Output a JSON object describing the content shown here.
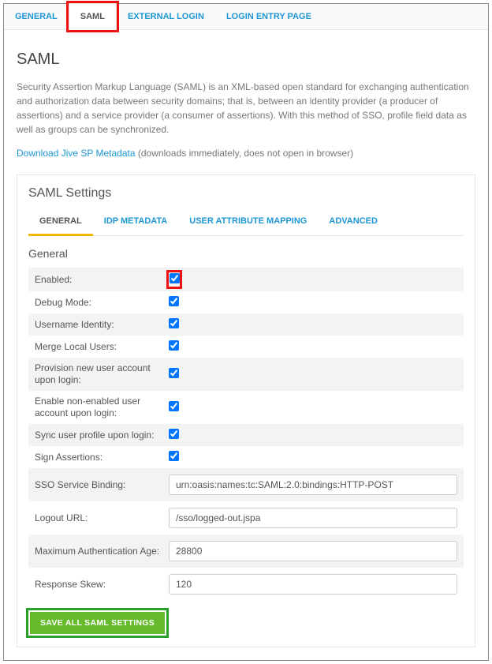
{
  "topnav": {
    "items": [
      {
        "label": "GENERAL"
      },
      {
        "label": "SAML"
      },
      {
        "label": "EXTERNAL LOGIN"
      },
      {
        "label": "LOGIN ENTRY PAGE"
      }
    ]
  },
  "page": {
    "title": "SAML",
    "description": "Security Assertion Markup Language (SAML) is an XML-based open standard for exchanging authentication and authorization data between security domains; that is, between an identity provider (a producer of assertions) and a service provider (a consumer of assertions). With this method of SSO, profile field data as well as groups can be synchronized.",
    "download_link": "Download Jive SP Metadata",
    "download_suffix": " (downloads immediately, does not open in browser)"
  },
  "settings": {
    "panel_title": "SAML Settings",
    "tabs": [
      {
        "label": "GENERAL"
      },
      {
        "label": "IDP METADATA"
      },
      {
        "label": "USER ATTRIBUTE MAPPING"
      },
      {
        "label": "ADVANCED"
      }
    ],
    "section_title": "General",
    "rows": {
      "enabled": {
        "label": "Enabled:"
      },
      "debug": {
        "label": "Debug Mode:"
      },
      "userid": {
        "label": "Username Identity:"
      },
      "merge": {
        "label": "Merge Local Users:"
      },
      "provision": {
        "label": "Provision new user account upon login:"
      },
      "enable_non": {
        "label": "Enable non-enabled user account upon login:"
      },
      "sync": {
        "label": "Sync user profile upon login:"
      },
      "sign": {
        "label": "Sign Assertions:"
      },
      "sso_binding": {
        "label": "SSO Service Binding:",
        "value": "urn:oasis:names:tc:SAML:2.0:bindings:HTTP-POST"
      },
      "logout_url": {
        "label": "Logout URL:",
        "value": "/sso/logged-out.jspa"
      },
      "max_auth_age": {
        "label": "Maximum Authentication Age:",
        "value": "28800"
      },
      "resp_skew": {
        "label": "Response Skew:",
        "value": "120"
      }
    },
    "save_label": "SAVE ALL SAML SETTINGS"
  }
}
